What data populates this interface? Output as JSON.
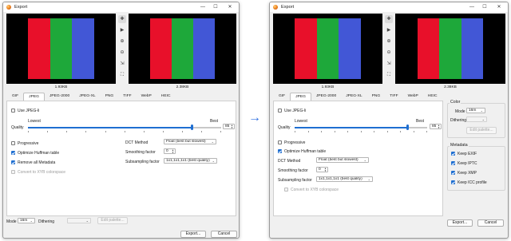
{
  "window": {
    "title": "Export",
    "min_icon": "minimize-icon",
    "max_icon": "maximize-icon",
    "close_icon": "close-icon",
    "min_glyph": "—",
    "max_glyph": "☐",
    "close_glyph": "✕"
  },
  "preview": {
    "left_size": "1.93KB",
    "right_size": "2.38KB",
    "bar_colors": [
      "#000000",
      "#e8102a",
      "#1ea83a",
      "#4257d6",
      "#000000"
    ]
  },
  "tools": [
    "✚",
    "▶",
    "⊕",
    "⊖",
    "⇲",
    "⛶"
  ],
  "tabs": [
    "GIF",
    "JPEG",
    "JPEG-2000",
    "JPEG-XL",
    "PNG",
    "TIFF",
    "WebP",
    "HEIC"
  ],
  "active_tab": "JPEG",
  "jpeg": {
    "use_jpeg_li": "Use JPEG-li",
    "lowest": "Lowest",
    "best": "Best",
    "quality_label": "Quality",
    "quality_value": "85",
    "quality_fraction": 0.85,
    "progressive": "Progressive",
    "optimize_huffman": "Optimize Huffman table",
    "remove_metadata": "Remove all Metadata",
    "convert_xyb": "Convert to XYB colorspace",
    "dct_label": "DCT Method",
    "dct_value": "Float (best but slowest)",
    "smoothing_label": "Smoothing factor",
    "smoothing_value": "0",
    "subsampling_label": "Subsampling factor",
    "subsampling_value": "1x1,1x1,1x1 (best quality)"
  },
  "bottom": {
    "mode_label": "Mode",
    "mode_value": "16m",
    "dithering_label": "Dithering",
    "edit_palette": "Edit palette...",
    "export": "Export...",
    "cancel": "Cancel"
  },
  "color_group": {
    "title": "Color",
    "mode_label": "Mode",
    "mode_value": "16m",
    "dithering_label": "Dithering",
    "edit_palette": "Edit palette..."
  },
  "metadata_group": {
    "title": "Metadata",
    "items": [
      "Keep EXIF",
      "Keep IPTC",
      "Keep XMP",
      "Keep ICC profile"
    ]
  },
  "arrow_glyph": "→"
}
